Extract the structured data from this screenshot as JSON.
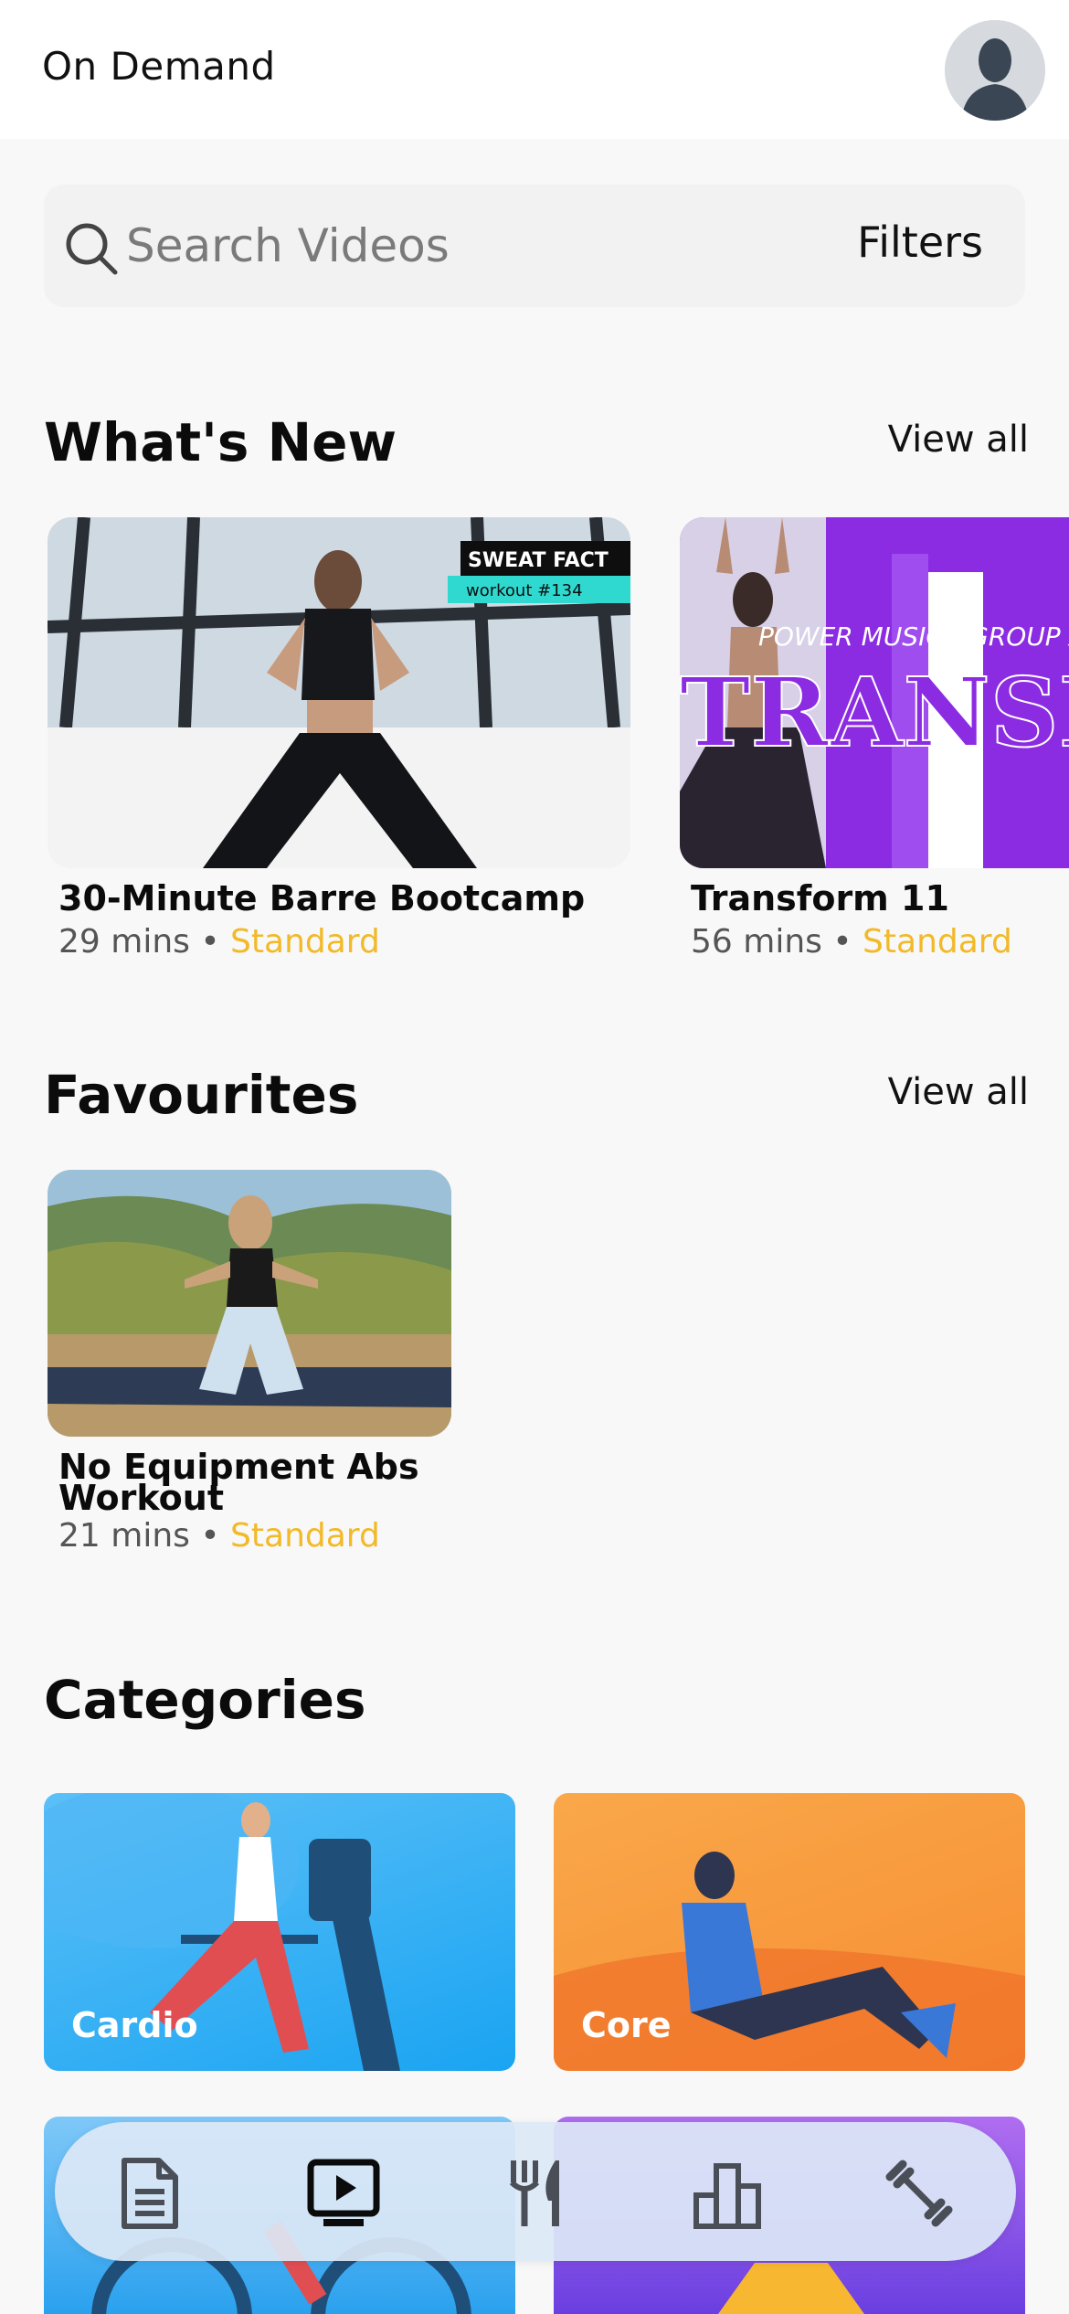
{
  "header": {
    "title": "On Demand"
  },
  "search": {
    "placeholder": "Search Videos",
    "filters_label": "Filters"
  },
  "whats_new": {
    "title": "What's New",
    "view_all": "View all",
    "items": [
      {
        "title": "30-Minute Barre Bootcamp",
        "duration": "29 mins",
        "separator": "•",
        "level": "Standard",
        "badge_line1": "SWEAT FACT",
        "badge_line2": "workout #134"
      },
      {
        "title": "Transform 11",
        "duration": "56 mins",
        "separator": "•",
        "level": "Standard",
        "banner_text": "POWER MUSIC | GROUP X",
        "big_text": "TRANSF"
      }
    ]
  },
  "favourites": {
    "title": "Favourites",
    "view_all": "View all",
    "items": [
      {
        "title_line1": "No Equipment Abs",
        "title_line2": "Workout",
        "duration": "21 mins",
        "separator": "•",
        "level": "Standard"
      }
    ]
  },
  "categories": {
    "title": "Categories",
    "items": [
      {
        "label": "Cardio",
        "color": "#3bb3f5"
      },
      {
        "label": "Core",
        "color": "#f79a3c"
      },
      {
        "label": "",
        "color": "#3aa8f0"
      },
      {
        "label": "",
        "color": "#8a48e6"
      }
    ]
  },
  "navbar": {
    "items": [
      {
        "icon": "document-icon",
        "active": false
      },
      {
        "icon": "video-player-icon",
        "active": true
      },
      {
        "icon": "fork-knife-icon",
        "active": false
      },
      {
        "icon": "bar-chart-icon",
        "active": false
      },
      {
        "icon": "dumbbell-icon",
        "active": false
      }
    ]
  },
  "colors": {
    "accent_level": "#f2b928",
    "background": "#f8f8f8",
    "nav_bg": "#dce8f6"
  }
}
